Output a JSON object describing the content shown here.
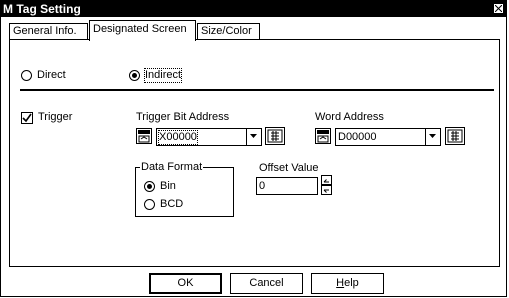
{
  "window": {
    "title": "M Tag Setting"
  },
  "tabs": [
    {
      "label": "General Info."
    },
    {
      "label": "Designated Screen"
    },
    {
      "label": "Size/Color"
    }
  ],
  "mode": {
    "direct_label": "Direct",
    "indirect_label": "Indirect",
    "selected": "Indirect"
  },
  "trigger": {
    "label": "Trigger",
    "checked": true
  },
  "trigger_bit_address": {
    "label": "Trigger Bit Address",
    "value": "X00000"
  },
  "word_address": {
    "label": "Word Address",
    "value": "D00000"
  },
  "data_format": {
    "title": "Data Format",
    "bin_label": "Bin",
    "bcd_label": "BCD",
    "selected": "Bin"
  },
  "offset": {
    "label": "Offset Value",
    "value": "0"
  },
  "buttons": {
    "ok": "OK",
    "cancel": "Cancel",
    "help_hotkey": "H",
    "help_rest": "elp"
  },
  "icons": {
    "close": "close-icon",
    "address_pick": "address-picker-icon",
    "dropdown": "chevron-down-icon",
    "keypad": "keypad-icon",
    "spin_up": "spin-up-icon",
    "spin_down": "spin-down-icon"
  }
}
